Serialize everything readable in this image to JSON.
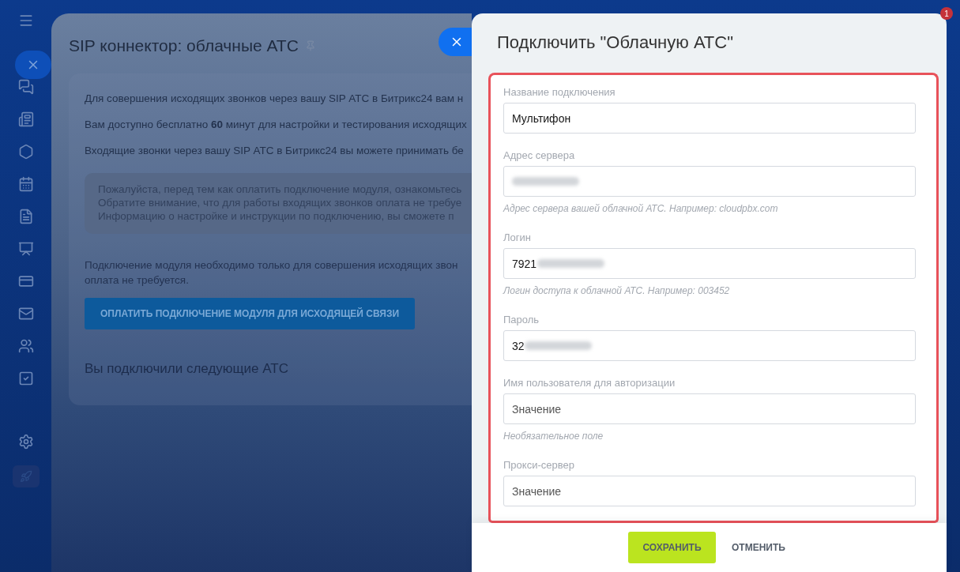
{
  "notifications": {
    "count": "1"
  },
  "page": {
    "title": "SIP коннектор: облачные АТС",
    "intro": [
      "Для совершения исходящих звонков через вашу SIP АТС в Битрикс24 вам н",
      "Вам доступно бесплатно **60** минут для настройки и тестирования исходящих",
      "Входящие звонки через вашу SIP АТС в Битрикс24 вы можете принимать бе"
    ],
    "notice": [
      "Пожалуйста, перед тем как оплатить подключение модуля, ознакомьтесь",
      "Обратите внимание, что для работы входящих звонков оплата не требуе",
      "Информацию о настройке и инструкции по подключению, вы сможете п"
    ],
    "module_text": [
      "Подключение модуля необходимо только для совершения исходящих звон",
      "оплата не требуется."
    ],
    "pay_button": "ОПЛАТИТЬ ПОДКЛЮЧЕНИЕ МОДУЛЯ ДЛЯ ИСХОДЯЩЕЙ СВЯЗИ",
    "connected_heading": "Вы подключили следующие АТС"
  },
  "slider": {
    "title": "Подключить \"Облачную АТС\"",
    "fields": [
      {
        "label": "Название подключения",
        "value": "Мультифон",
        "blurred": false
      },
      {
        "label": "Адрес сервера",
        "blurred": true,
        "hint": "Адрес сервера вашей облачной АТС. Например: cloudpbx.com"
      },
      {
        "label": "Логин",
        "value": "7921",
        "blurred": true,
        "hint": "Логин доступа к облачной АТС. Например: 003452"
      },
      {
        "label": "Пароль",
        "value": "32",
        "blurred": true
      },
      {
        "label": "Имя пользователя для авторизации",
        "placeholder": "Значение",
        "blurred": false,
        "hint": "Необязательное поле"
      },
      {
        "label": "Прокси-сервер",
        "placeholder": "Значение",
        "blurred": false
      }
    ],
    "save_button": "СОХРАНИТЬ",
    "cancel_button": "ОТМЕНИТЬ"
  }
}
